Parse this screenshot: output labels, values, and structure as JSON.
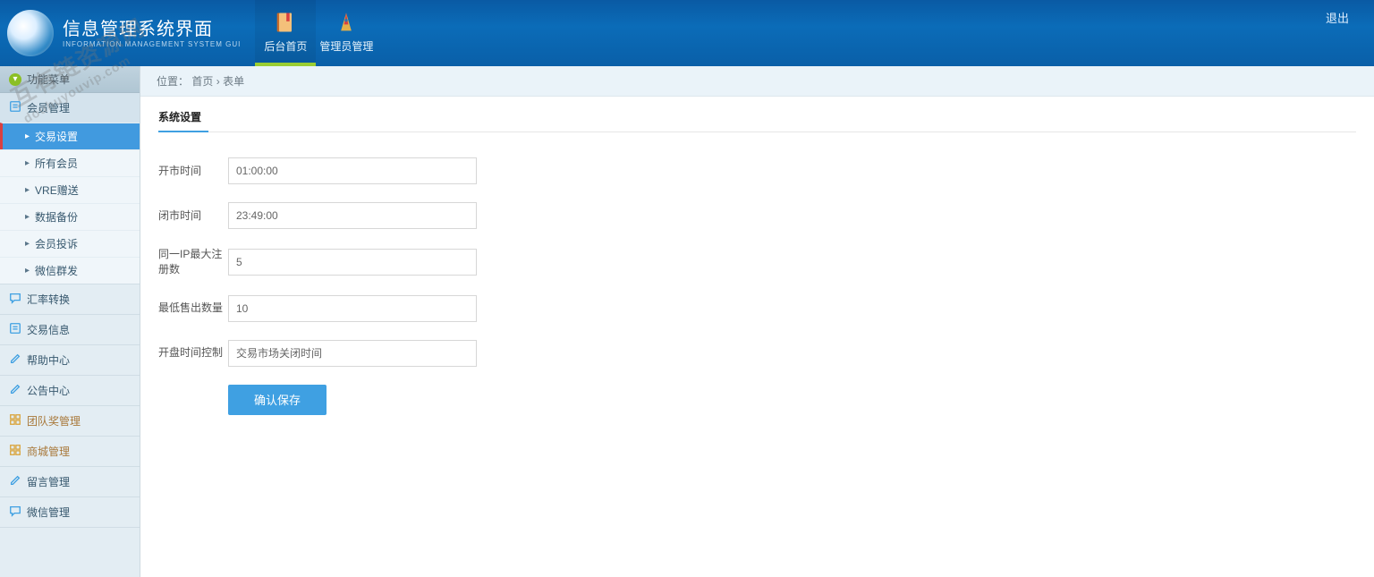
{
  "watermark": {
    "cn": "互有链资源网",
    "en": "douhuyouvip.com"
  },
  "header": {
    "title_cn": "信息管理系统界面",
    "title_en": "INFORMATION MANAGEMENT SYSTEM GUI",
    "logout": "退出",
    "nav": [
      {
        "id": "home",
        "label": "后台首页",
        "active": true
      },
      {
        "id": "admin",
        "label": "管理员管理",
        "active": false
      }
    ]
  },
  "sidebar": {
    "head": "功能菜单",
    "sections": [
      {
        "id": "member",
        "label": "会员管理",
        "icon": "doc-icon",
        "color": "#3fa0e2",
        "expanded": true,
        "items": [
          {
            "id": "trade-set",
            "label": "交易设置",
            "active": true
          },
          {
            "id": "all-member",
            "label": "所有会员"
          },
          {
            "id": "vre",
            "label": "VRE赠送"
          },
          {
            "id": "backup",
            "label": "数据备份"
          },
          {
            "id": "complaint",
            "label": "会员投诉"
          },
          {
            "id": "wechat-mass",
            "label": "微信群发"
          }
        ]
      },
      {
        "id": "rate",
        "label": "汇率转换",
        "icon": "chat-icon",
        "color": "#3fa0e2"
      },
      {
        "id": "trade-info",
        "label": "交易信息",
        "icon": "doc-icon",
        "color": "#3fa0e2"
      },
      {
        "id": "help",
        "label": "帮助中心",
        "icon": "edit-icon",
        "color": "#3fa0e2"
      },
      {
        "id": "notice",
        "label": "公告中心",
        "icon": "edit-icon",
        "color": "#3fa0e2"
      },
      {
        "id": "team",
        "label": "团队奖管理",
        "icon": "grid-icon",
        "color": "#d9a33a"
      },
      {
        "id": "mall",
        "label": "商城管理",
        "icon": "grid-icon",
        "color": "#d9a33a"
      },
      {
        "id": "message",
        "label": "留言管理",
        "icon": "edit-icon",
        "color": "#3fa0e2"
      },
      {
        "id": "wechat",
        "label": "微信管理",
        "icon": "chat-icon",
        "color": "#3fa0e2"
      }
    ]
  },
  "breadcrumb": {
    "label": "位置：",
    "home": "首页",
    "sep": "›",
    "current": "表单"
  },
  "panel": {
    "title": "系统设置",
    "fields": {
      "open_time": {
        "label": "开市时间",
        "value": "01:00:00"
      },
      "close_time": {
        "label": "闭市时间",
        "value": "23:49:00"
      },
      "max_reg": {
        "label": "同一IP最大注册数",
        "value": "5"
      },
      "min_sell": {
        "label": "最低售出数量",
        "value": "10"
      },
      "open_ctrl": {
        "label": "开盘时间控制",
        "value": "交易市场关闭时间"
      }
    },
    "submit": "确认保存"
  }
}
